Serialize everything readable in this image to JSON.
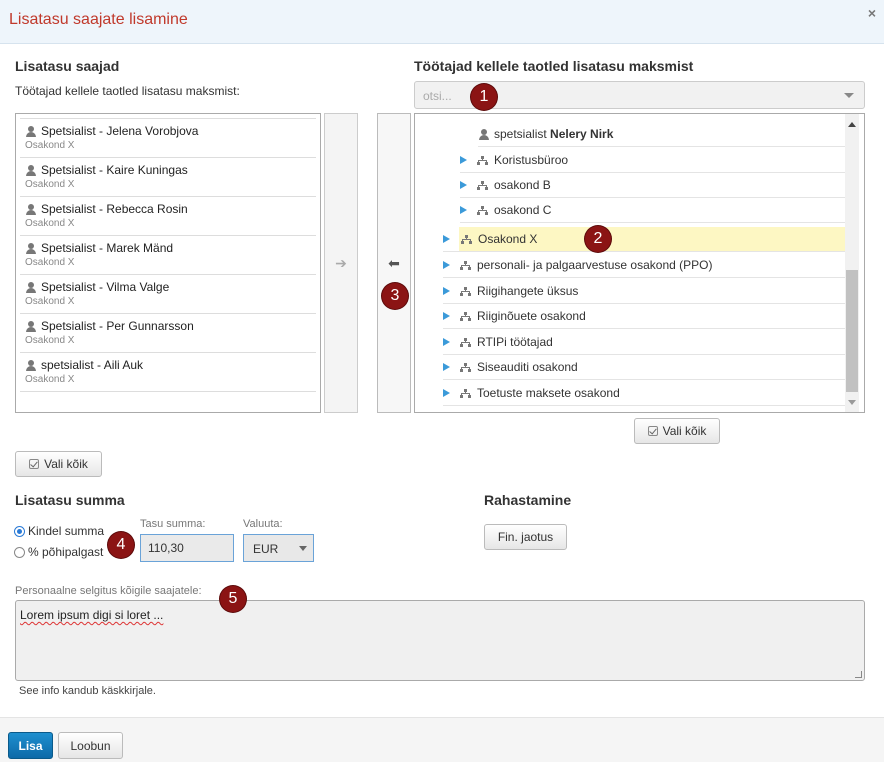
{
  "dialog": {
    "title": "Lisatasu saajate lisamine",
    "close": "×"
  },
  "left": {
    "heading": "Lisatasu saajad",
    "subheading": "Töötajad kellele taotled lisatasu maksmist:",
    "items": [
      {
        "name": "Spetsialist - Jelena Vorobjova",
        "unit": "Osakond X"
      },
      {
        "name": "Spetsialist - Kaire Kuningas",
        "unit": "Osakond X"
      },
      {
        "name": "Spetsialist - Rebecca Rosin",
        "unit": "Osakond X"
      },
      {
        "name": "Spetsialist - Marek Mänd",
        "unit": "Osakond X"
      },
      {
        "name": "Spetsialist - Vilma Valge",
        "unit": "Osakond X"
      },
      {
        "name": "Spetsialist - Per Gunnarsson",
        "unit": "Osakond X"
      },
      {
        "name": "spetsialist - Aili Auk",
        "unit": "Osakond X"
      }
    ],
    "select_all": "Vali kõik"
  },
  "move": {
    "right": "➔",
    "left": "⬅"
  },
  "right": {
    "heading": "Töötajad kellele taotled lisatasu maksmist",
    "search_placeholder": "otsi...",
    "tree": {
      "person_prefix": "spetsialist",
      "person_name": "Nelery Nirk",
      "sub_items": [
        "Koristusbüroo",
        "osakond B",
        "osakond C"
      ],
      "selected": "Osakond X",
      "items": [
        "personali- ja palgaarvestuse osakond (PPO)",
        "Riigihangete üksus",
        "Riiginõuete osakond",
        "RTIPi töötajad",
        "Siseauditi osakond",
        "Toetuste maksete osakond"
      ]
    },
    "select_all": "Vali kõik"
  },
  "amount": {
    "heading": "Lisatasu summa",
    "option_fixed": "Kindel summa",
    "option_percent": "% põhipalgast",
    "sum_label": "Tasu summa:",
    "sum_value": "110,30",
    "currency_label": "Valuuta:",
    "currency_value": "EUR"
  },
  "funding": {
    "heading": "Rahastamine",
    "button": "Fin. jaotus"
  },
  "explanation": {
    "label": "Personaalne selgitus kõigile saajatele:",
    "value": "Lorem ipsum digi si loret ...",
    "hint": "See info kandub käskkirjale."
  },
  "markers": [
    "1",
    "2",
    "3",
    "4",
    "5"
  ],
  "footer": {
    "add": "Lisa",
    "cancel": "Loobun"
  }
}
